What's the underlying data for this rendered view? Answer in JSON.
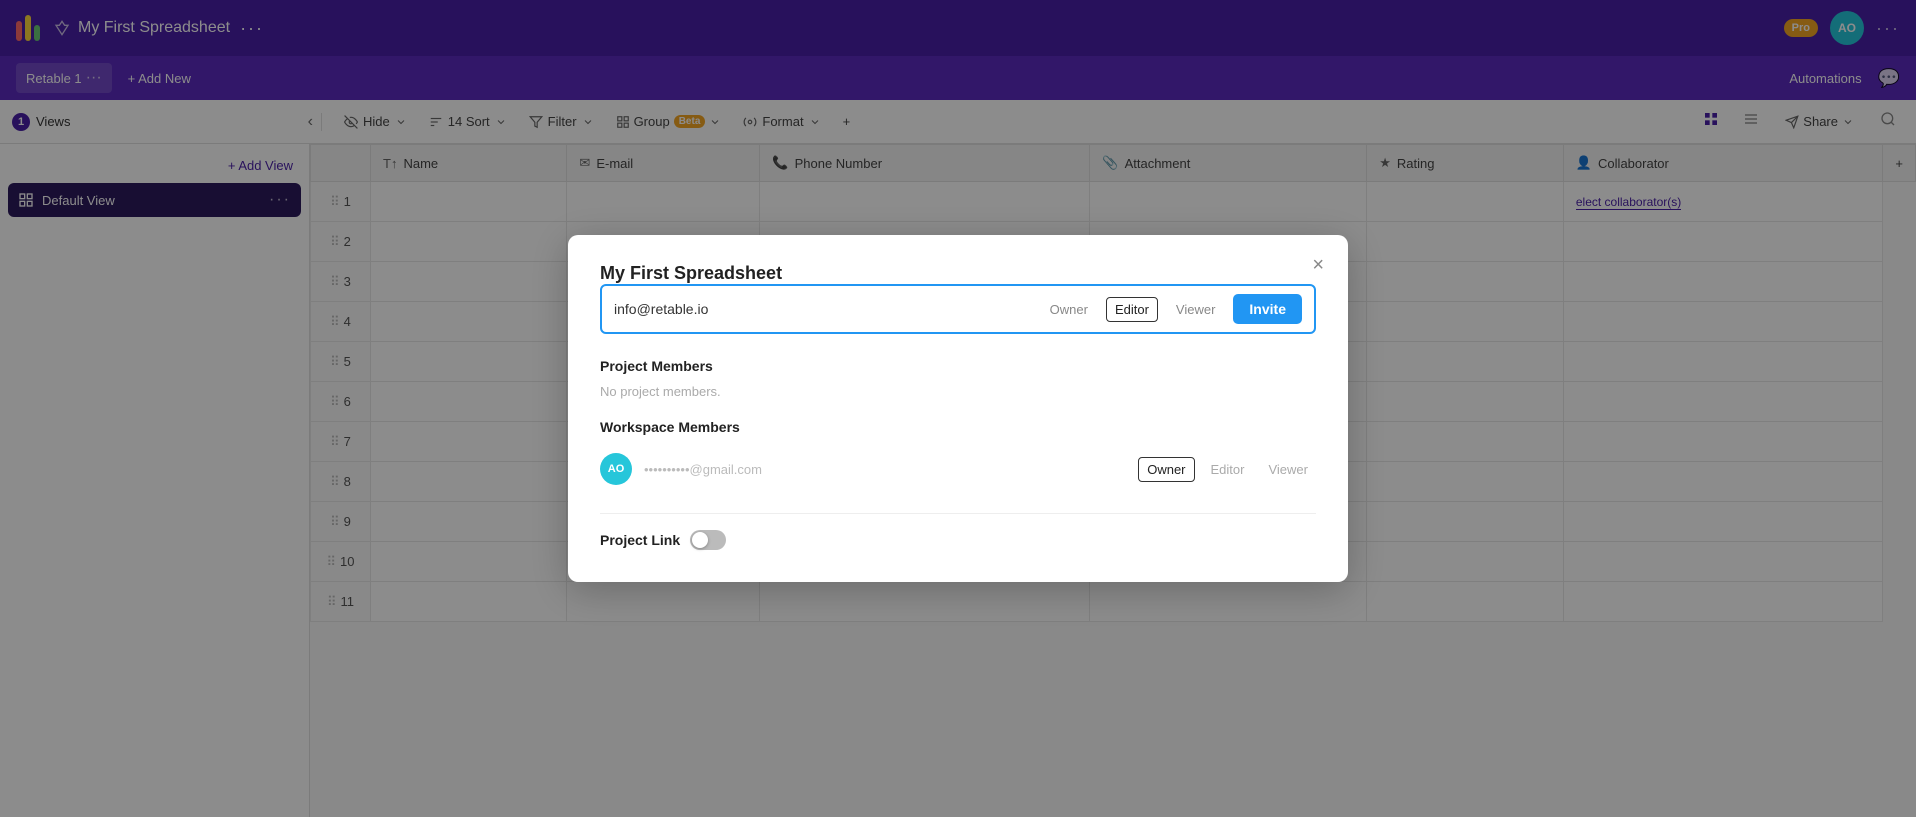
{
  "app": {
    "logo_bars": [
      "#ff6b6b",
      "#ffd93d",
      "#6bcb77"
    ],
    "title": "My First Spreadsheet",
    "title_icon": "pin-icon",
    "more_options_label": "···"
  },
  "top_bar_right": {
    "pro_label": "Pro",
    "avatar_label": "AO",
    "more_label": "···"
  },
  "tab_bar": {
    "tab_label": "Retable 1",
    "tab_dots": "···",
    "add_new_label": "+ Add New",
    "automations_label": "Automations",
    "chat_icon": "chat-icon"
  },
  "toolbar": {
    "views_count": "1",
    "views_label": "Views",
    "hide_label": "Hide",
    "sort_label": "14 Sort",
    "filter_label": "Filter",
    "group_label": "Group",
    "group_beta": "Beta",
    "format_label": "Format",
    "plus_label": "+",
    "share_label": "Share",
    "search_icon": "search-icon",
    "grid_icon": "grid-icon",
    "list_icon": "list-icon",
    "send_icon": "send-icon"
  },
  "sidebar": {
    "add_view_label": "+ Add View",
    "default_view_label": "Default View",
    "default_view_icon": "grid-view-icon"
  },
  "table": {
    "columns": [
      {
        "id": "name",
        "label": "Name",
        "icon": "text-icon"
      },
      {
        "id": "email",
        "label": "E-mail",
        "icon": "email-icon"
      },
      {
        "id": "phone",
        "label": "Phone Number",
        "icon": "phone-icon"
      },
      {
        "id": "attachment",
        "label": "Attachment",
        "icon": "attachment-icon"
      },
      {
        "id": "rating",
        "label": "Rating",
        "icon": "star-icon"
      },
      {
        "id": "collaborator",
        "label": "Collaborator",
        "icon": "person-icon"
      }
    ],
    "rows": [
      1,
      2,
      3,
      4,
      5,
      6,
      7,
      8,
      9,
      10,
      11
    ],
    "select_collaborators": "elect collaborator(s)"
  },
  "modal": {
    "title": "My First Spreadsheet",
    "close_label": "×",
    "invite_placeholder": "info@retable.io",
    "invite_roles": [
      {
        "label": "Owner",
        "active": false
      },
      {
        "label": "Editor",
        "active": true
      },
      {
        "label": "Viewer",
        "active": false
      }
    ],
    "invite_btn_label": "Invite",
    "project_members_title": "Project Members",
    "no_members_label": "No project members.",
    "workspace_members_title": "Workspace Members",
    "workspace_member": {
      "avatar": "AO",
      "email": "••••••••••@gmail.com",
      "roles": [
        {
          "label": "Owner",
          "active": true
        },
        {
          "label": "Editor",
          "active": false
        },
        {
          "label": "Viewer",
          "active": false
        }
      ]
    },
    "project_link_label": "Project Link",
    "toggle_state": "off"
  }
}
